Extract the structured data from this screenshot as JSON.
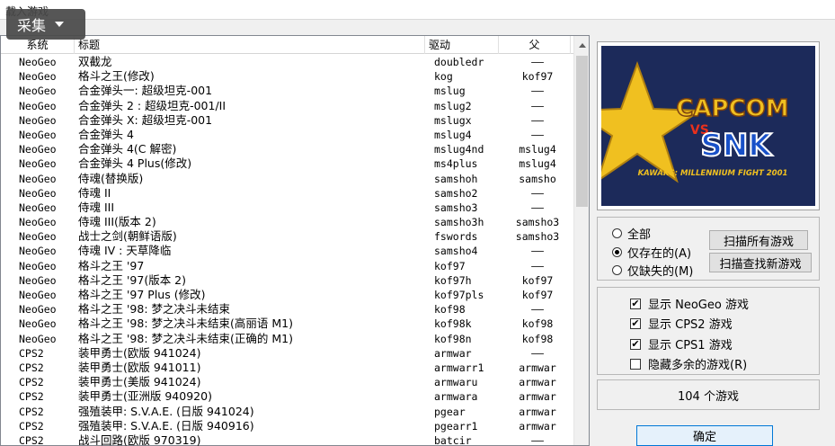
{
  "window": {
    "title": "载入游戏"
  },
  "capture_button": {
    "label": "采集"
  },
  "columns": {
    "system": "系统",
    "title": "标题",
    "driver": "驱动",
    "parent": "父"
  },
  "rows": [
    {
      "system": "NeoGeo",
      "title": "双截龙",
      "driver": "doubledr",
      "parent": "——"
    },
    {
      "system": "NeoGeo",
      "title": "格斗之王(修改)",
      "driver": "kog",
      "parent": "kof97"
    },
    {
      "system": "NeoGeo",
      "title": "合金弹头一: 超级坦克-001",
      "driver": "mslug",
      "parent": "——"
    },
    {
      "system": "NeoGeo",
      "title": "合金弹头 2 : 超级坦克-001/II",
      "driver": "mslug2",
      "parent": "——"
    },
    {
      "system": "NeoGeo",
      "title": "合金弹头 X: 超级坦克-001",
      "driver": "mslugx",
      "parent": "——"
    },
    {
      "system": "NeoGeo",
      "title": "合金弹头 4",
      "driver": "mslug4",
      "parent": "——"
    },
    {
      "system": "NeoGeo",
      "title": "合金弹头 4(C 解密)",
      "driver": "mslug4nd",
      "parent": "mslug4"
    },
    {
      "system": "NeoGeo",
      "title": "合金弹头 4 Plus(修改)",
      "driver": "ms4plus",
      "parent": "mslug4"
    },
    {
      "system": "NeoGeo",
      "title": "侍魂(替换版)",
      "driver": "samshoh",
      "parent": "samsho"
    },
    {
      "system": "NeoGeo",
      "title": "侍魂 II",
      "driver": "samsho2",
      "parent": "——"
    },
    {
      "system": "NeoGeo",
      "title": "侍魂 III",
      "driver": "samsho3",
      "parent": "——"
    },
    {
      "system": "NeoGeo",
      "title": "侍魂 III(版本 2)",
      "driver": "samsho3h",
      "parent": "samsho3"
    },
    {
      "system": "NeoGeo",
      "title": "战士之剑(朝鲜语版)",
      "driver": "fswords",
      "parent": "samsho3"
    },
    {
      "system": "NeoGeo",
      "title": "侍魂 IV : 天草降临",
      "driver": "samsho4",
      "parent": "——"
    },
    {
      "system": "NeoGeo",
      "title": "格斗之王 '97",
      "driver": "kof97",
      "parent": "——"
    },
    {
      "system": "NeoGeo",
      "title": "格斗之王 '97(版本 2)",
      "driver": "kof97h",
      "parent": "kof97"
    },
    {
      "system": "NeoGeo",
      "title": "格斗之王 '97 Plus (修改)",
      "driver": "kof97pls",
      "parent": "kof97"
    },
    {
      "system": "NeoGeo",
      "title": "格斗之王 '98: 梦之决斗未结束",
      "driver": "kof98",
      "parent": "——"
    },
    {
      "system": "NeoGeo",
      "title": "格斗之王 '98: 梦之决斗未结束(高丽语 M1)",
      "driver": "kof98k",
      "parent": "kof98"
    },
    {
      "system": "NeoGeo",
      "title": "格斗之王 '98: 梦之决斗未结束(正确的 M1)",
      "driver": "kof98n",
      "parent": "kof98"
    },
    {
      "system": "CPS2",
      "title": "装甲勇士(欧版 941024)",
      "driver": "armwar",
      "parent": "——"
    },
    {
      "system": "CPS2",
      "title": "装甲勇士(欧版 941011)",
      "driver": "armwarr1",
      "parent": "armwar"
    },
    {
      "system": "CPS2",
      "title": "装甲勇士(美版 941024)",
      "driver": "armwaru",
      "parent": "armwar"
    },
    {
      "system": "CPS2",
      "title": "装甲勇士(亚洲版 940920)",
      "driver": "armwara",
      "parent": "armwar"
    },
    {
      "system": "CPS2",
      "title": "强殖装甲: S.V.A.E. (日版 941024)",
      "driver": "pgear",
      "parent": "armwar"
    },
    {
      "system": "CPS2",
      "title": "强殖装甲: S.V.A.E. (日版 940916)",
      "driver": "pgearr1",
      "parent": "armwar"
    },
    {
      "system": "CPS2",
      "title": "战斗回路(欧版 970319)",
      "driver": "batcir",
      "parent": "——"
    }
  ],
  "filter": {
    "all": "全部",
    "existing": "仅存在的(A)",
    "missing": "仅缺失的(M)",
    "selected": "existing"
  },
  "buttons": {
    "scan_all": "扫描所有游戏",
    "scan_new": "扫描查找新游戏",
    "ok": "确定"
  },
  "options": [
    {
      "label": "显示 NeoGeo 游戏",
      "checked": true
    },
    {
      "label": "显示 CPS2 游戏",
      "checked": true
    },
    {
      "label": "显示 CPS1 游戏",
      "checked": true
    },
    {
      "label": "隐藏多余的游戏(R)",
      "checked": false
    }
  ],
  "status": {
    "game_count": "104 个游戏"
  },
  "preview": {
    "logo_top": "CAPCOM",
    "logo_vs": "VS.",
    "logo_bottom": "SNK",
    "logo_sub": "KAWAKS: MILLENNIUM FIGHT 2001"
  },
  "colors": {
    "preview_bg": "#1c2a5a",
    "logo_red": "#e8301c",
    "logo_gold": "#f0c020",
    "logo_blue": "#1850c8"
  }
}
